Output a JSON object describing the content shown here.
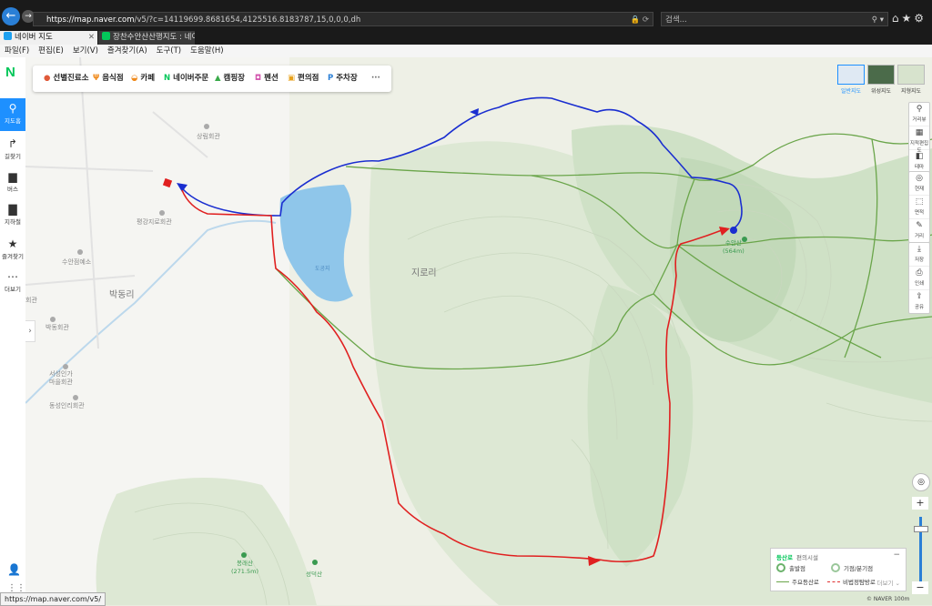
{
  "browser": {
    "url_host": "https://map.naver.com",
    "url_path": "/v5/?c=14119699.8681654,4125516.8183787,15,0,0,0,dh",
    "url_icons": "🔒 ⟳",
    "search_placeholder": "검색...",
    "tabs": [
      {
        "label": "네이버 지도",
        "active": true
      },
      {
        "label": "장찬수안산산행지도 : 네이버...",
        "active": false
      }
    ],
    "menu": [
      "파일(F)",
      "편집(E)",
      "보기(V)",
      "즐겨찾기(A)",
      "도구(T)",
      "도움말(H)"
    ],
    "status_url": "https://map.naver.com/v5/"
  },
  "sidebar": {
    "logo": "N",
    "items": [
      {
        "label": "지도홈",
        "icon": "map-pin-icon",
        "glyph": "⚲"
      },
      {
        "label": "길찾기",
        "icon": "directions-icon",
        "glyph": "↱"
      },
      {
        "label": "버스",
        "icon": "bus-icon",
        "glyph": "▆"
      },
      {
        "label": "지하철",
        "icon": "subway-icon",
        "glyph": "▇"
      },
      {
        "label": "즐겨찾기",
        "icon": "star-icon",
        "glyph": "★"
      },
      {
        "label": "더보기",
        "icon": "more-icon",
        "glyph": "⋯"
      }
    ]
  },
  "categories": [
    {
      "label": "선별진료소",
      "glyph": "●",
      "color": "#e05a3a"
    },
    {
      "label": "음식점",
      "glyph": "Ψ",
      "color": "#f08a1c"
    },
    {
      "label": "카페",
      "glyph": "◒",
      "color": "#f08a1c"
    },
    {
      "label": "네이버주문",
      "glyph": "N",
      "color": "#03c75a"
    },
    {
      "label": "캠핑장",
      "glyph": "▲",
      "color": "#3aaa4a"
    },
    {
      "label": "펜션",
      "glyph": "◘",
      "color": "#d45ab0"
    },
    {
      "label": "편의점",
      "glyph": "▣",
      "color": "#e8a21c"
    },
    {
      "label": "주차장",
      "glyph": "P",
      "color": "#2a7fd6"
    }
  ],
  "more_categories": "···",
  "layers": [
    {
      "label": "일반지도",
      "selected": true
    },
    {
      "label": "위성지도",
      "selected": false
    },
    {
      "label": "지형지도",
      "selected": false
    }
  ],
  "tools_top": [
    {
      "label": "거리뷰",
      "glyph": "⚲"
    },
    {
      "label": "지적편집도",
      "glyph": "▦"
    },
    {
      "label": "테마",
      "glyph": "◧"
    }
  ],
  "tools_mid": [
    {
      "label": "현재",
      "glyph": "◎"
    },
    {
      "label": "면적",
      "glyph": "⬚"
    },
    {
      "label": "거리",
      "glyph": "✎"
    }
  ],
  "tools_bot": [
    {
      "label": "저장",
      "glyph": "⤓"
    },
    {
      "label": "인쇄",
      "glyph": "⎙"
    },
    {
      "label": "공유",
      "glyph": "⇪"
    }
  ],
  "zoom": {
    "in": "+",
    "out": "−",
    "compass": "◎"
  },
  "map_labels": {
    "sangrim": "상림회관",
    "pyeonggang": "평강지로회관",
    "suan": "수안점예소",
    "bakdong_ri": "박동리",
    "bakdong_hall": "박동회관",
    "seoseong": "서성인가\n마을회관",
    "dongseong": "동성인리회관",
    "jiro_ri": "지로리",
    "reservoir": "도공지",
    "suan_peak": "수안산\n(564m)",
    "bongrae_peak": "봉래산\n(271.5m)",
    "seongdeok_peak": "성덕산",
    "hoegwan_left": "회관"
  },
  "legend": {
    "title": "등산로",
    "subtitle": "편의시설",
    "start": "출발점",
    "junction": "기점/분기점",
    "main_trail": "주요등산로",
    "other_trail": "비법정탐방로",
    "more": "더보기 ⌄",
    "minimize": "−",
    "colors": {
      "trail": "#6aa54a",
      "route_red": "#e02020",
      "route_blue": "#1a2ed0"
    }
  },
  "scale": "© NAVER  100m"
}
